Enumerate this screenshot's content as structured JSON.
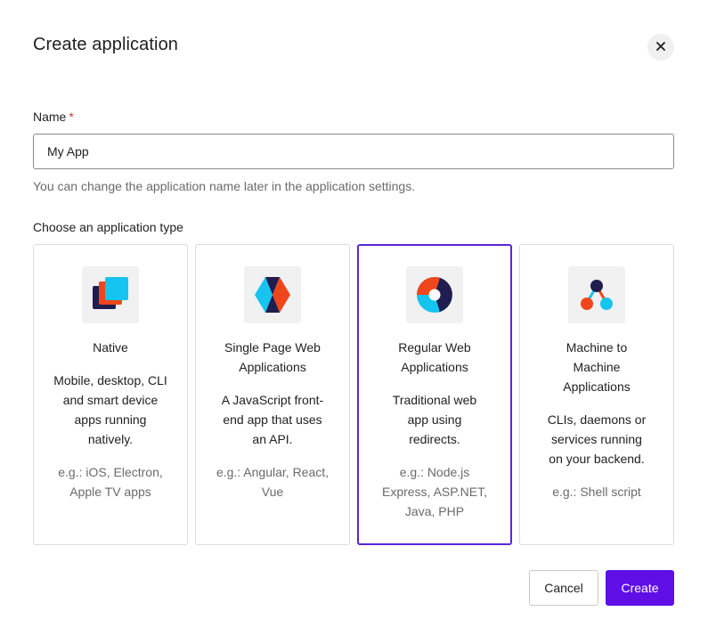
{
  "dialog": {
    "title": "Create application",
    "close_icon": "close-icon"
  },
  "name_field": {
    "label": "Name",
    "required_marker": "*",
    "value": "My App",
    "hint": "You can change the application name later in the application settings."
  },
  "type_section": {
    "label": "Choose an application type",
    "selected": "regular-web",
    "cards": [
      {
        "id": "native",
        "icon": "native-app-icon",
        "title": "Native",
        "description": "Mobile, desktop, CLI and smart device apps running natively.",
        "example": "e.g.: iOS, Electron, Apple TV apps"
      },
      {
        "id": "spa",
        "icon": "spa-icon",
        "title": "Single Page Web Applications",
        "description": "A JavaScript front-end app that uses an API.",
        "example": "e.g.: Angular, React, Vue"
      },
      {
        "id": "regular-web",
        "icon": "regular-web-app-icon",
        "title": "Regular Web Applications",
        "description": "Traditional web app using redirects.",
        "example": "e.g.: Node.js Express, ASP.NET, Java, PHP"
      },
      {
        "id": "m2m",
        "icon": "machine-to-machine-icon",
        "title": "Machine to Machine Applications",
        "description": "CLIs, daemons or services running on your backend.",
        "example": "e.g.: Shell script"
      }
    ]
  },
  "footer": {
    "cancel_label": "Cancel",
    "create_label": "Create"
  },
  "colors": {
    "accent": "#5f0ee6",
    "selected_border": "#5c26db",
    "required": "#d03c38"
  }
}
